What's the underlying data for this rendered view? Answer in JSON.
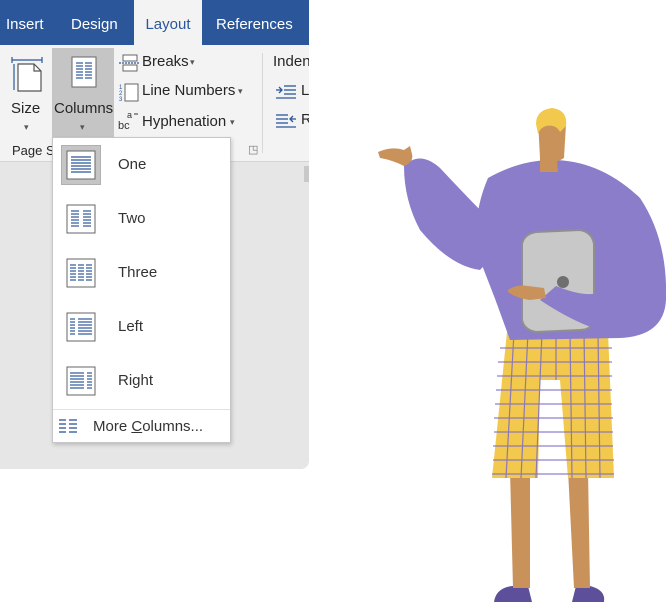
{
  "tabs": [
    {
      "label": "Insert",
      "active": false
    },
    {
      "label": "Design",
      "active": false
    },
    {
      "label": "Layout",
      "active": true
    },
    {
      "label": "References",
      "active": false
    }
  ],
  "ribbon": {
    "size_label": "Size",
    "columns_label": "Columns",
    "breaks_label": "Breaks",
    "line_numbers_label": "Line Numbers",
    "hyphenation_label": "Hyphenation",
    "indent_label": "Inden",
    "indent_left_label": "Le",
    "indent_right_label": "R",
    "group_page_setup_label": "Page S"
  },
  "columns_menu": {
    "items": [
      {
        "label": "One",
        "selected": true
      },
      {
        "label": "Two",
        "selected": false
      },
      {
        "label": "Three",
        "selected": false
      },
      {
        "label": "Left",
        "selected": false
      },
      {
        "label": "Right",
        "selected": false
      }
    ],
    "more_prefix": "More ",
    "more_underlined": "C",
    "more_suffix": "olumns..."
  },
  "colors": {
    "tab_bar": "#2b579a",
    "ribbon": "#f3f3f3",
    "sweater": "#8b7dc9",
    "shorts": "#f2c94c",
    "skin": "#c9925a",
    "hair": "#f2c94c"
  },
  "icons": [
    "size-icon",
    "columns-icon",
    "breaks-icon",
    "line-numbers-icon",
    "hyphenation-icon",
    "indent-left-icon",
    "indent-right-icon",
    "dialog-launcher-icon",
    "more-columns-icon"
  ]
}
